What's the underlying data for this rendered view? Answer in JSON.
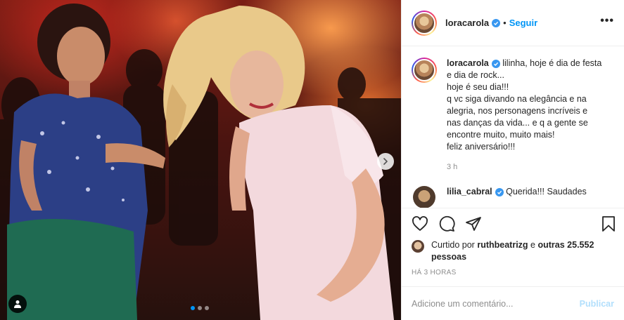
{
  "post": {
    "author": "loracarola",
    "follow_label": "Seguir",
    "dot": "•",
    "more_icon": "more-icon"
  },
  "caption": {
    "author": "loracarola",
    "first_line": "lilinha, hoje é dia de festa",
    "lines": [
      "e dia de rock...",
      "hoje é seu dia!!!",
      "q vc siga divando na elegância e na",
      "alegria, nos personagens incríveis e",
      "nas danças da vida... e q a gente se",
      "encontre muito, muito mais!",
      "feliz aniversário!!!"
    ],
    "time": "3 h"
  },
  "comments": [
    {
      "author": "lilia_cabral",
      "text": "Querida!!! Saudades"
    }
  ],
  "likes": {
    "prefix": "Curtido por",
    "user": "ruthbeatrizg",
    "connector": "e",
    "others": "outras 25.552 pessoas"
  },
  "posted_ago": "HÁ 3 HORAS",
  "add_comment": {
    "placeholder": "Adicione um comentário...",
    "publish_label": "Publicar"
  },
  "carousel": {
    "count": 3,
    "active": 0
  },
  "colors": {
    "accent": "#0095f6",
    "verified": "#3897f0",
    "publish_disabled": "#b2dffc",
    "muted": "#8e8e8e"
  }
}
